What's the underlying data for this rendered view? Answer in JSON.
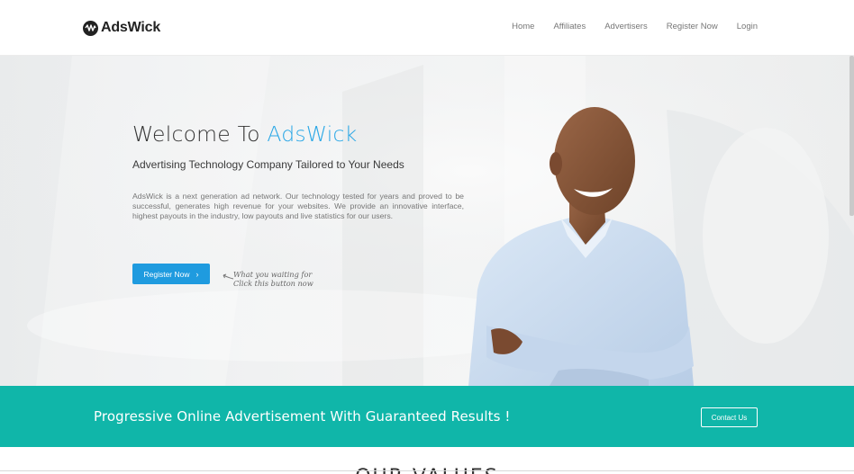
{
  "brand": {
    "name": "AdsWick",
    "logo_icon": "wave-icon"
  },
  "nav": {
    "items": [
      {
        "label": "Home"
      },
      {
        "label": "Affiliates"
      },
      {
        "label": "Advertisers"
      },
      {
        "label": "Register Now"
      },
      {
        "label": "Login"
      }
    ]
  },
  "hero": {
    "title_prefix": "Welcome To ",
    "title_accent": "AdsWick",
    "subtitle": "Advertising Technology Company Tailored to Your Needs",
    "description": "AdsWick is a next generation ad network. Our technology tested for years and proved to be successful, generates high revenue for your websites. We provide an innovative interface, highest payouts in the industry, low payouts and live statistics for our users.",
    "cta_label": "Register Now",
    "cta_icon": "chevron-right-icon",
    "hint_line1": "What you waiting for",
    "hint_line2": "Click this button now"
  },
  "band": {
    "text": "Progressive Online Advertisement With Guaranteed Results !",
    "button_label": "Contact Us"
  },
  "section": {
    "title": "OUR VALUES"
  },
  "colors": {
    "accent": "#2aa7e6",
    "button": "#1f9bdf",
    "band": "#10b6a9"
  }
}
